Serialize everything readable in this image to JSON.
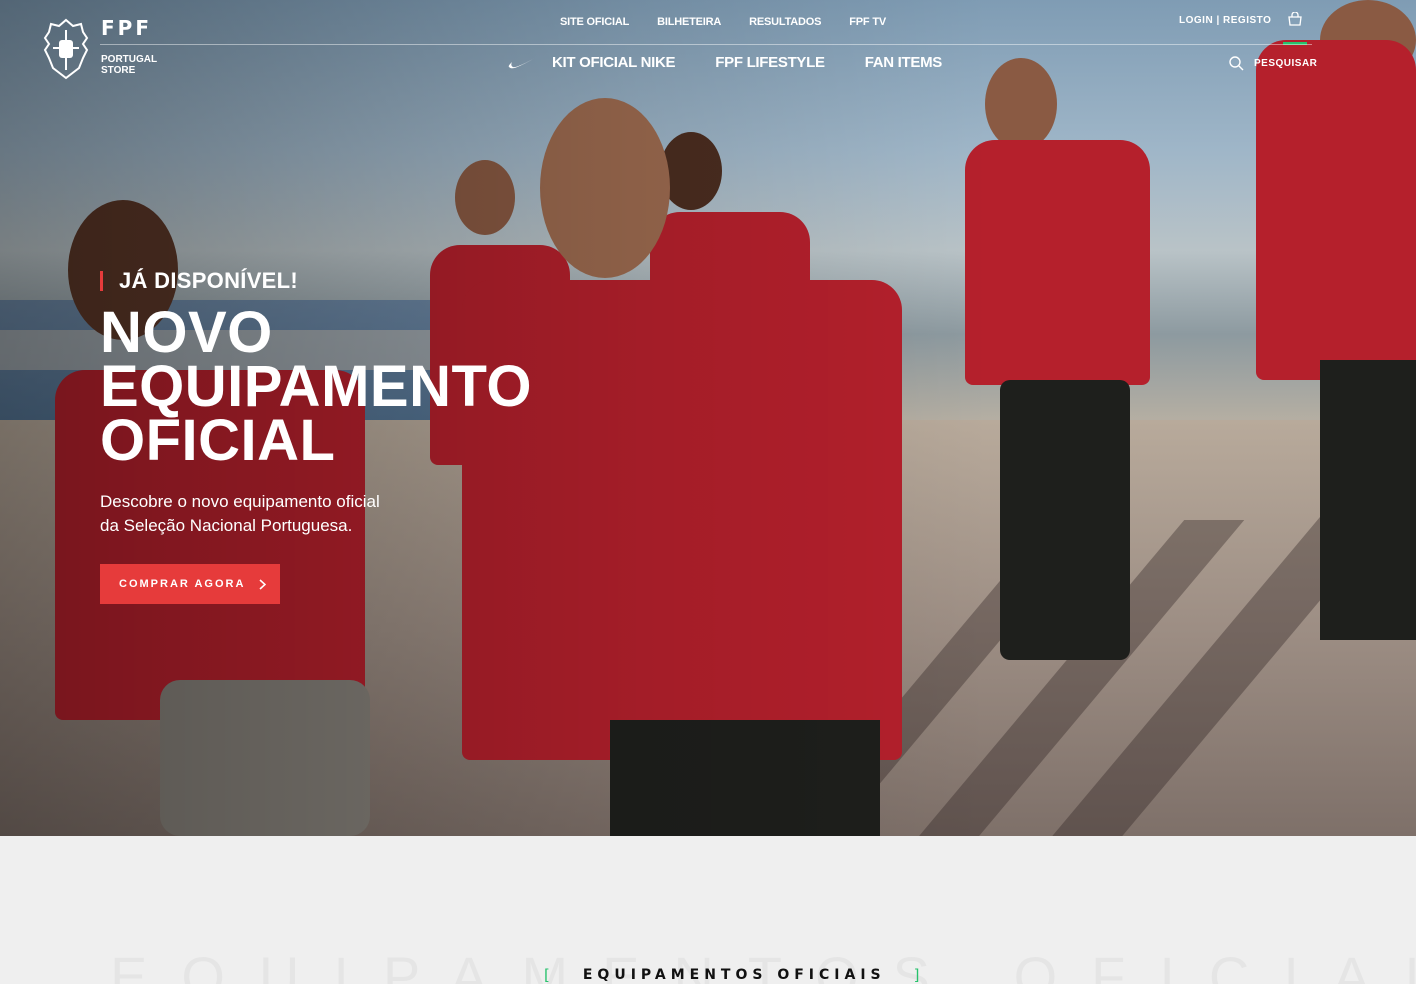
{
  "brand": {
    "title": "FPF",
    "subtitle": "PORTUGAL STORE"
  },
  "top_nav": [
    "SITE OFICIAL",
    "BILHETEIRA",
    "RESULTADOS",
    "FPF TV"
  ],
  "account": {
    "label": "LOGIN | REGISTO"
  },
  "main_nav": [
    "KIT OFICIAL NIKE",
    "FPF LIFESTYLE",
    "FAN ITEMS"
  ],
  "search": {
    "label": "PESQUISAR"
  },
  "hero": {
    "eyebrow": "JÁ DISPONÍVEL!",
    "headline": "NOVO EQUIPAMENTO OFICIAL",
    "description": "Descobre o novo equipamento oficial da Seleção Nacional Portuguesa.",
    "cta": "COMPRAR AGORA"
  },
  "section": {
    "title": "EQUIPAMENTOS OFICIAIS",
    "ghost_text": "EQUIPAMENTOS OFICIAIS"
  },
  "icons": [
    "fpf-crest-icon",
    "cart-icon",
    "nike-swoosh-icon",
    "search-icon",
    "chevron-right-icon"
  ],
  "colors": {
    "accent": "#e63b3b",
    "green": "#27c26c",
    "shirt": "#b5202c"
  }
}
